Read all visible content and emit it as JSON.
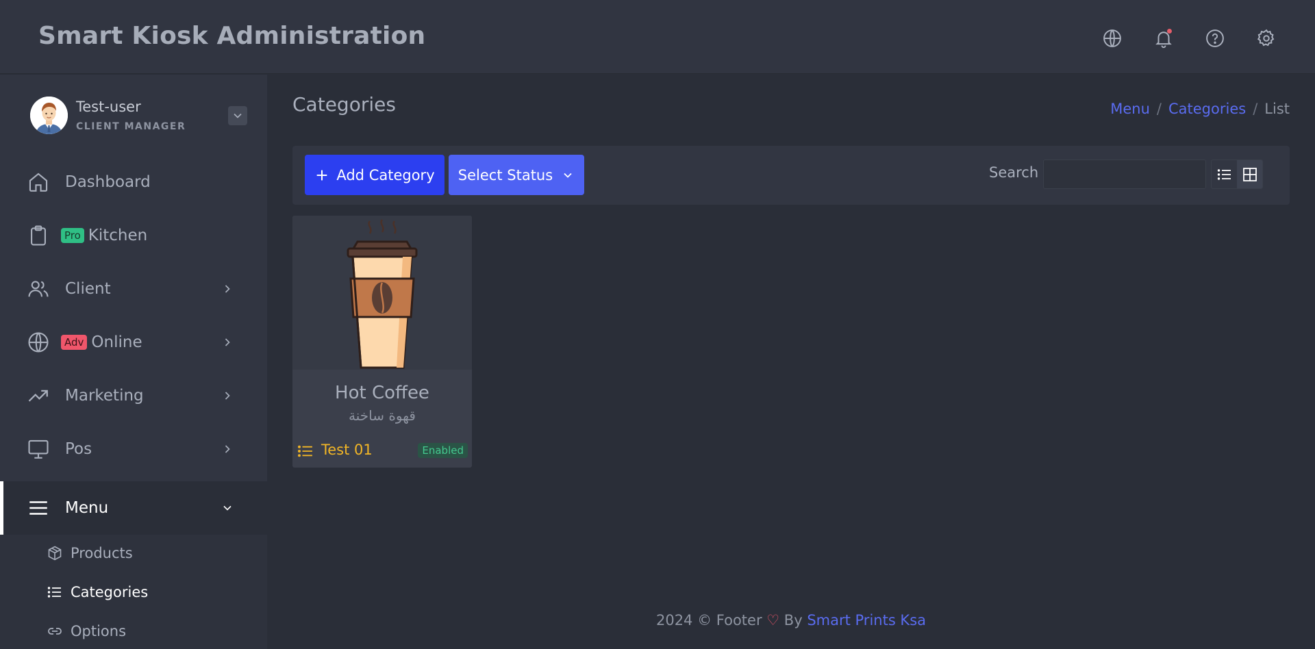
{
  "header": {
    "title": "Smart Kiosk Administration",
    "icons": [
      "globe-icon",
      "bell-icon",
      "help-icon",
      "gear-icon"
    ]
  },
  "user": {
    "name": "Test-user",
    "role": "CLIENT MANAGER"
  },
  "sidebar": {
    "items": [
      {
        "label": "Dashboard",
        "icon": "home-icon"
      },
      {
        "label": "Kitchen",
        "icon": "clipboard-icon",
        "badge": "Pro"
      },
      {
        "label": "Client",
        "icon": "users-icon"
      },
      {
        "label": "Online",
        "icon": "globe-icon",
        "badge": "Adv"
      },
      {
        "label": "Marketing",
        "icon": "trending-up-icon"
      },
      {
        "label": "Pos",
        "icon": "monitor-icon"
      },
      {
        "label": "Menu",
        "icon": "menu-icon"
      }
    ],
    "submenu": [
      {
        "label": "Products",
        "icon": "box-icon"
      },
      {
        "label": "Categories",
        "icon": "list-icon"
      },
      {
        "label": "Options",
        "icon": "link-icon"
      }
    ]
  },
  "page": {
    "title": "Categories",
    "breadcrumb": [
      "Menu",
      "Categories",
      "List"
    ]
  },
  "toolbar": {
    "add_label": "Add Category",
    "status_label": "Select Status",
    "search_label": "Search",
    "search_value": ""
  },
  "categories": [
    {
      "name": "Hot Coffee",
      "name_ar": "قهوة ساخنة",
      "kiosk": "Test 01",
      "status": "Enabled"
    }
  ],
  "footer": {
    "text": "2024 © Footer",
    "by": "By",
    "link": "Smart Prints Ksa"
  },
  "colors": {
    "accent": "#2c3ff0",
    "status_enabled": "#44c98f",
    "badge_pro": "#2fbf85",
    "badge_adv": "#f0566b",
    "warning_text": "#f2b626"
  }
}
